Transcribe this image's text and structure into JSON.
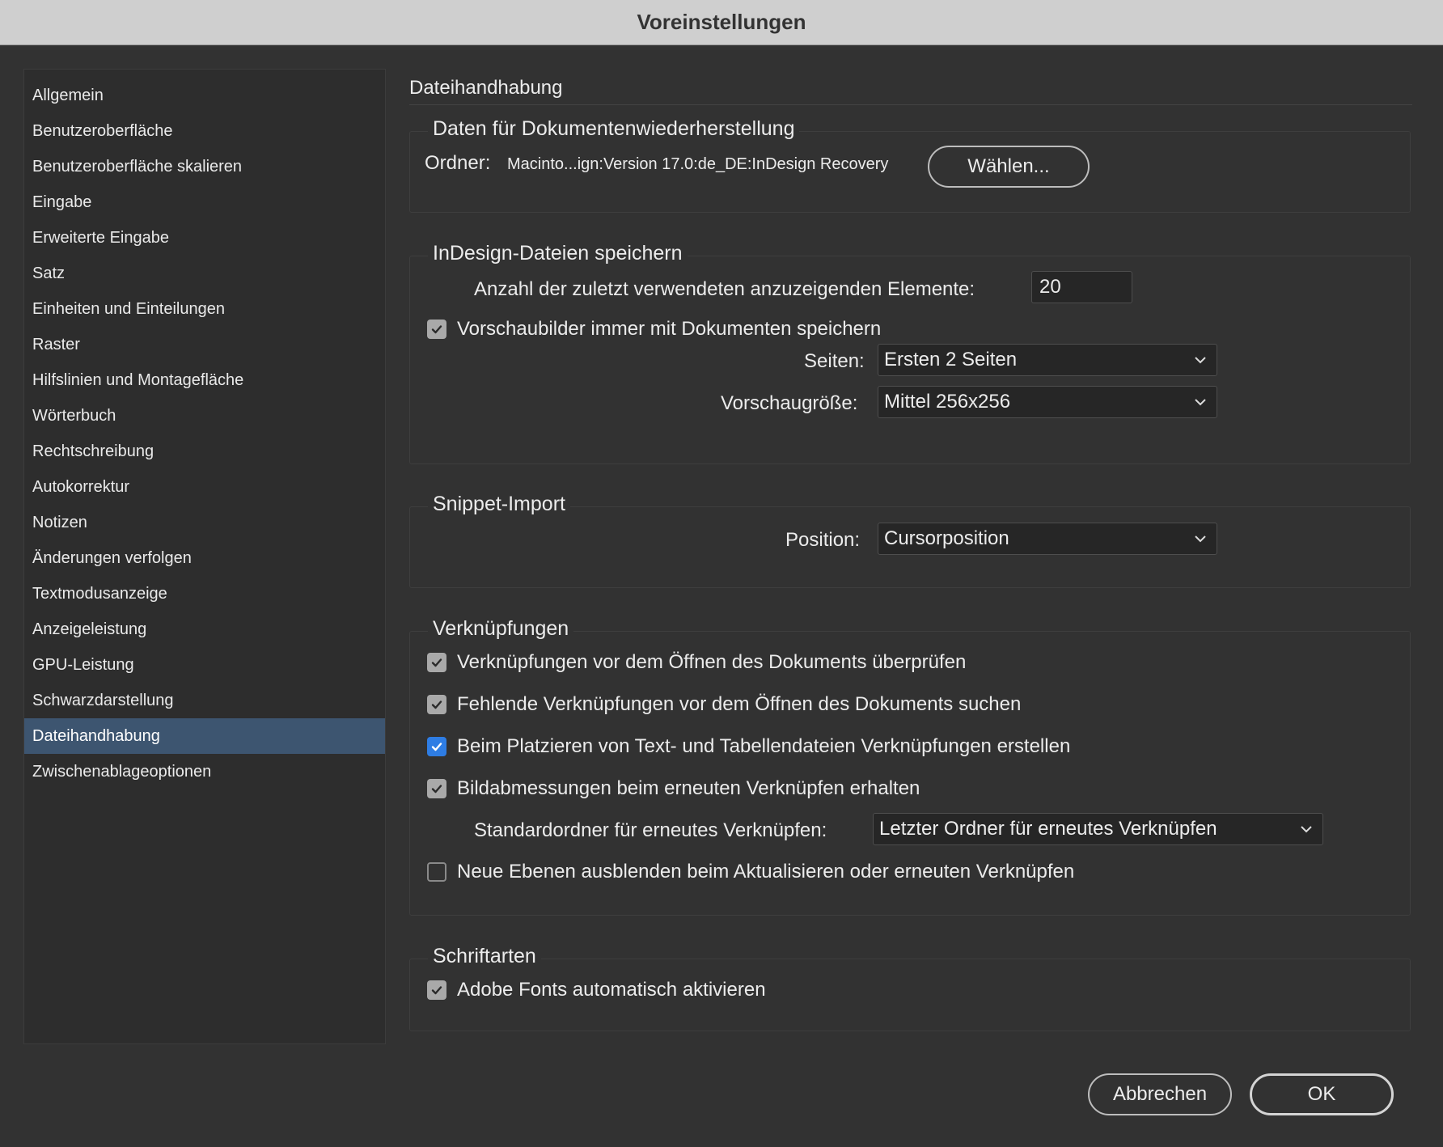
{
  "window": {
    "title": "Voreinstellungen"
  },
  "sidebar": {
    "items": [
      {
        "label": "Allgemein"
      },
      {
        "label": "Benutzeroberfläche"
      },
      {
        "label": "Benutzeroberfläche skalieren"
      },
      {
        "label": "Eingabe"
      },
      {
        "label": "Erweiterte Eingabe"
      },
      {
        "label": "Satz"
      },
      {
        "label": "Einheiten und Einteilungen"
      },
      {
        "label": "Raster"
      },
      {
        "label": "Hilfslinien und Montagefläche"
      },
      {
        "label": "Wörterbuch"
      },
      {
        "label": "Rechtschreibung"
      },
      {
        "label": "Autokorrektur"
      },
      {
        "label": "Notizen"
      },
      {
        "label": "Änderungen verfolgen"
      },
      {
        "label": "Textmodusanzeige"
      },
      {
        "label": "Anzeigeleistung"
      },
      {
        "label": "GPU-Leistung"
      },
      {
        "label": "Schwarzdarstellung"
      },
      {
        "label": "Dateihandhabung"
      },
      {
        "label": "Zwischenablageoptionen"
      }
    ],
    "selected": "Dateihandhabung"
  },
  "page": {
    "title": "Dateihandhabung"
  },
  "recovery": {
    "title": "Daten für Dokumentenwiederherstellung",
    "folder_label": "Ordner:",
    "folder_path": "Macinto...ign:Version 17.0:de_DE:InDesign Recovery",
    "choose_button": "Wählen..."
  },
  "save": {
    "title": "InDesign-Dateien speichern",
    "recent_label": "Anzahl der zuletzt verwendeten anzuzeigenden Elemente:",
    "recent_value": "20",
    "preview_checkbox": "Vorschaubilder immer mit Dokumenten speichern",
    "preview_checked": true,
    "pages_label": "Seiten:",
    "pages_value": "Ersten 2 Seiten",
    "size_label": "Vorschaugröße:",
    "size_value": "Mittel 256x256"
  },
  "snippet": {
    "title": "Snippet-Import",
    "position_label": "Position:",
    "position_value": "Cursorposition"
  },
  "links": {
    "title": "Verknüpfungen",
    "check_before_open": "Verknüpfungen vor dem Öffnen des Dokuments überprüfen",
    "find_missing": "Fehlende Verknüpfungen vor dem Öffnen des Dokuments suchen",
    "create_links": "Beim Platzieren von Text- und Tabellendateien Verknüpfungen erstellen",
    "preserve_dimensions": "Bildabmessungen beim erneuten Verknüpfen erhalten",
    "default_folder_label": "Standardordner für erneutes Verknüpfen:",
    "default_folder_value": "Letzter Ordner für erneutes Verknüpfen",
    "hide_layers": "Neue Ebenen ausblenden beim Aktualisieren oder erneuten Verknüpfen"
  },
  "fonts": {
    "title": "Schriftarten",
    "auto_activate": "Adobe Fonts automatisch aktivieren"
  },
  "footer": {
    "cancel": "Abbrechen",
    "ok": "OK"
  },
  "colors": {
    "selected_item": "#3d5570",
    "checkbox_blue": "#2e7de4",
    "checkbox_gray": "#a9a9a9"
  }
}
